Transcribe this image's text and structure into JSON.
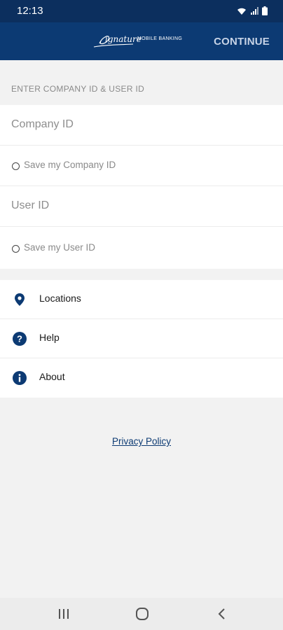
{
  "status_bar": {
    "time": "12:13"
  },
  "header": {
    "logo_script": "Signature",
    "logo_tagline": "MOBILE BANKING",
    "continue_label": "CONTINUE"
  },
  "form": {
    "section_label": "ENTER COMPANY ID & USER ID",
    "company_id": {
      "placeholder": "Company ID",
      "value": ""
    },
    "save_company_label": "Save my Company ID",
    "user_id": {
      "placeholder": "User ID",
      "value": ""
    },
    "save_user_label": "Save my User ID"
  },
  "menu": {
    "items": [
      {
        "label": "Locations",
        "icon": "location-pin-icon"
      },
      {
        "label": "Help",
        "icon": "help-icon"
      },
      {
        "label": "About",
        "icon": "info-icon"
      }
    ]
  },
  "footer": {
    "privacy_label": "Privacy Policy"
  },
  "colors": {
    "header_bg": "#0c3a73",
    "status_bg": "#0c2f5e",
    "accent": "#0c3a73",
    "page_bg": "#f2f2f2"
  }
}
